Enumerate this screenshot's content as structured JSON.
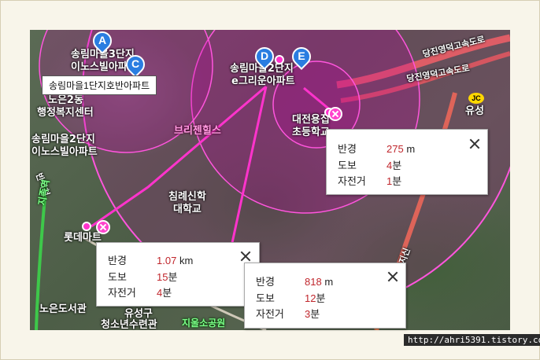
{
  "place_tooltip": "송림마을1단지호반아파트",
  "markers": [
    {
      "letter": "A"
    },
    {
      "letter": "C"
    },
    {
      "letter": "D"
    },
    {
      "letter": "E"
    }
  ],
  "map_labels": {
    "songrim3": "송림마을3단지",
    "inosville1": "이노스빌아파트",
    "noeun2_1": "노은2동",
    "noeun2_2": "행정복지센터",
    "songrim2_2": "송림마을2단지",
    "inosville2": "이노스빌아파트",
    "brighthills": "브리젠힐스",
    "songrim2b": "송림마을2단지",
    "egreen": "e그리운아파트",
    "daejeon1": "대전용집",
    "daejeon2": "초등학교",
    "chimrye1": "침례신학",
    "chimrye2": "대학교",
    "lotte": "롯데마트",
    "library": "노은도서관",
    "yuseong_gu": "유성구",
    "youth": "청소년수련관",
    "jiul": "지울소공원",
    "yuseong_jc": "유성",
    "jc": "JC",
    "banseok": "반석천",
    "jisik": "지족역",
    "expressway": "당진영덕고속도로",
    "expressway2": "당진영덕고속도로",
    "jisin": "지신"
  },
  "info_boxes": [
    {
      "radius_label": "반경",
      "radius_value": "275",
      "radius_unit": "m",
      "walk_label": "도보",
      "walk_value": "4",
      "walk_unit": "분",
      "bike_label": "자전거",
      "bike_value": "1",
      "bike_unit": "분"
    },
    {
      "radius_label": "반경",
      "radius_value": "1.07",
      "radius_unit": "km",
      "walk_label": "도보",
      "walk_value": "15",
      "walk_unit": "분",
      "bike_label": "자전거",
      "bike_value": "4",
      "bike_unit": "분"
    },
    {
      "radius_label": "반경",
      "radius_value": "818",
      "radius_unit": "m",
      "walk_label": "도보",
      "walk_value": "12",
      "walk_unit": "분",
      "bike_label": "자전거",
      "bike_value": "3",
      "bike_unit": "분"
    }
  ],
  "watermark": "http://ahri5391.tistory.com",
  "colors": {
    "route": "#ff33cc",
    "circle_fill": "#c000a0",
    "marker": "#2a7de1",
    "value_red": "#c0262c"
  }
}
